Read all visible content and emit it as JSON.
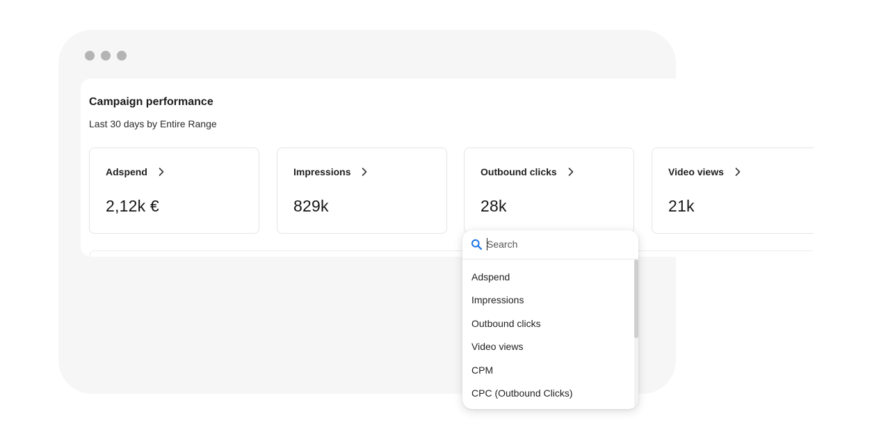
{
  "panel": {
    "title": "Campaign performance",
    "subtitle": "Last 30 days by Entire Range"
  },
  "cards": [
    {
      "label": "Adspend",
      "value": "2,12k €"
    },
    {
      "label": "Impressions",
      "value": "829k"
    },
    {
      "label": "Outbound clicks",
      "value": "28k"
    },
    {
      "label": "Video views",
      "value": "21k"
    }
  ],
  "dropdown": {
    "search_placeholder": "Search",
    "options": [
      "Adspend",
      "Impressions",
      "Outbound clicks",
      "Video views",
      "CPM",
      "CPC (Outbound Clicks)"
    ]
  },
  "icons": {
    "card_arrow": "chevron-right-icon",
    "search": "search-icon"
  },
  "colors": {
    "window_bg": "#f6f6f6",
    "accent": "#1a73e8",
    "dot": "#b4b4b4"
  }
}
